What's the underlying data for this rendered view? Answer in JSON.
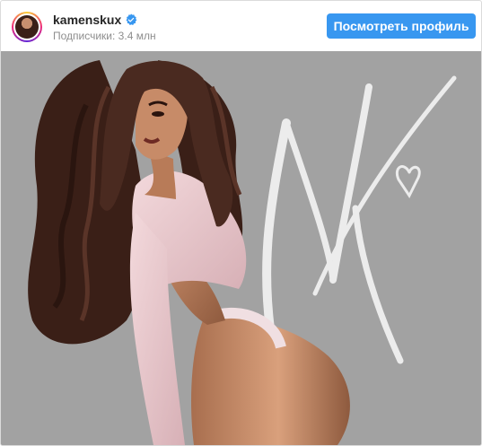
{
  "header": {
    "username": "kamenskux",
    "verified_icon": "verified-badge-icon",
    "followers_text": "Подписчики: 3.4 млн",
    "view_profile_label": "Посмотреть профиль"
  },
  "media": {
    "signature_text": "NK",
    "image_subject": "illustration"
  },
  "colors": {
    "button_blue": "#3897f0",
    "verified_blue": "#3897f0",
    "media_background": "#a2a2a2",
    "username": "#262626",
    "secondary_text": "#8e8e8e"
  }
}
